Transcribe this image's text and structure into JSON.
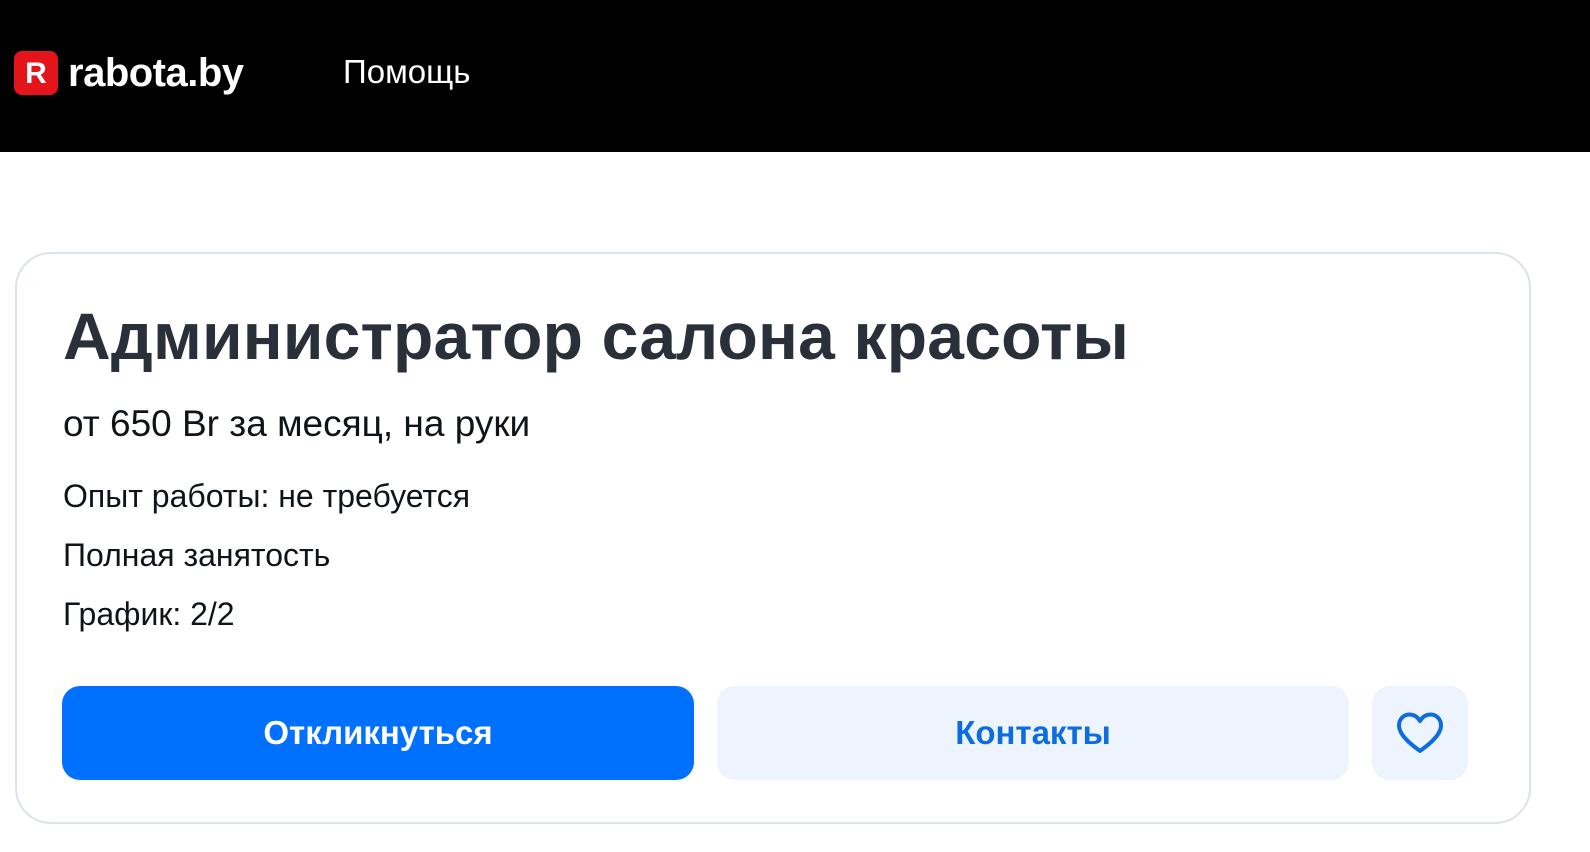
{
  "header": {
    "logo_badge": "R",
    "logo_text": "rabota.by",
    "nav_help": "Помощь"
  },
  "vacancy": {
    "title": "Администратор салона красоты",
    "salary": "от 650 Br за месяц, на руки",
    "experience": "Опыт работы: не требуется",
    "employment": "Полная занятость",
    "schedule": "График: 2/2"
  },
  "actions": {
    "respond_label": "Откликнуться",
    "contacts_label": "Контакты",
    "favorite_icon": "heart-icon"
  },
  "colors": {
    "header_bg": "#000000",
    "brand_red": "#e3151a",
    "primary_blue": "#0070ff",
    "secondary_bg": "#edf4fd",
    "secondary_text": "#0d6de0"
  }
}
